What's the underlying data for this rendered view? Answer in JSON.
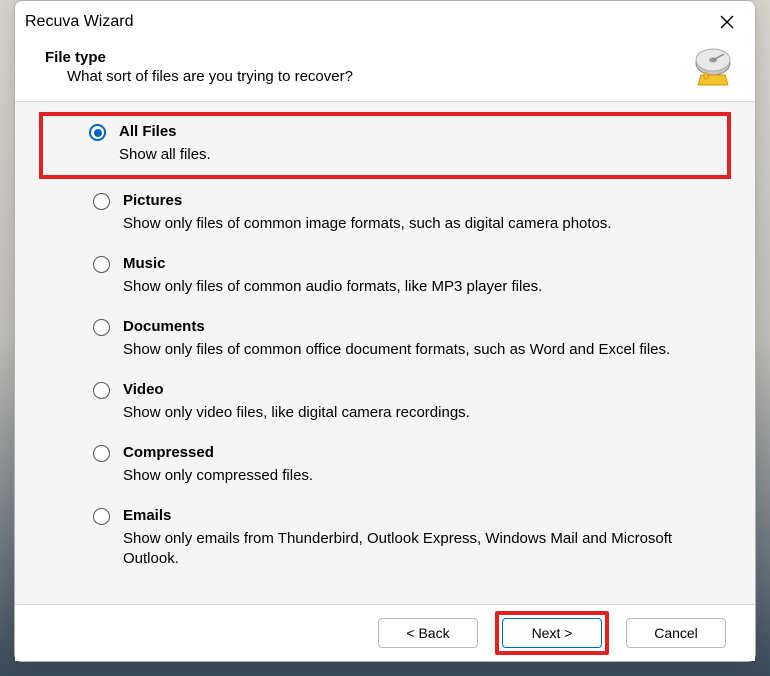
{
  "window": {
    "title": "Recuva Wizard"
  },
  "header": {
    "title": "File type",
    "description": "What sort of files are you trying to recover?"
  },
  "options": [
    {
      "label": "All Files",
      "description": "Show all files.",
      "selected": true,
      "highlighted": true
    },
    {
      "label": "Pictures",
      "description": "Show only files of common image formats, such as digital camera photos.",
      "selected": false,
      "highlighted": false
    },
    {
      "label": "Music",
      "description": "Show only files of common audio formats, like MP3 player files.",
      "selected": false,
      "highlighted": false
    },
    {
      "label": "Documents",
      "description": "Show only files of common office document formats, such as Word and Excel files.",
      "selected": false,
      "highlighted": false
    },
    {
      "label": "Video",
      "description": "Show only video files, like digital camera recordings.",
      "selected": false,
      "highlighted": false
    },
    {
      "label": "Compressed",
      "description": "Show only compressed files.",
      "selected": false,
      "highlighted": false
    },
    {
      "label": "Emails",
      "description": "Show only emails from Thunderbird, Outlook Express, Windows Mail and Microsoft Outlook.",
      "selected": false,
      "highlighted": false
    }
  ],
  "buttons": {
    "back": "< Back",
    "next": "Next >",
    "cancel": "Cancel"
  }
}
